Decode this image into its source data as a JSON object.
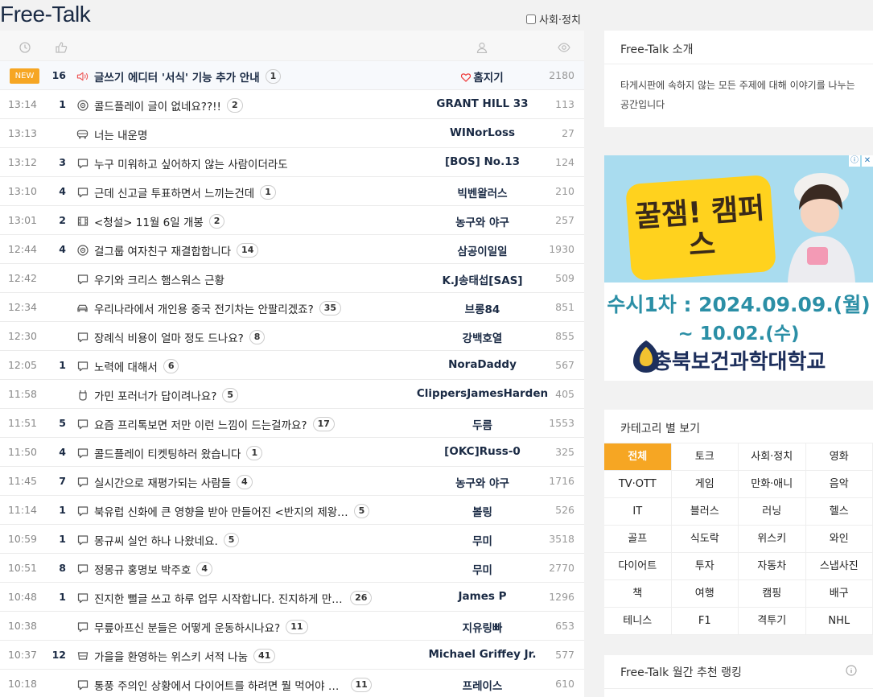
{
  "header": {
    "title": "Free-Talk",
    "filter_label": "사회·정치"
  },
  "board": {
    "new_label": "NEW",
    "rows": [
      {
        "time": "",
        "is_notice": true,
        "rec": "16",
        "icon": "speaker-icon",
        "title": "글쓰기 에디터 '서식' 기능 추가 안내",
        "comments": "1",
        "author": "홈지기",
        "views": "2180"
      },
      {
        "time": "13:14",
        "rec": "1",
        "icon": "target-icon",
        "title": "콜드플레이 글이 없네요??!!",
        "comments": "2",
        "author": "GRANT HILL 33",
        "views": "113"
      },
      {
        "time": "13:13",
        "rec": "",
        "icon": "bus-icon",
        "title": "너는 내운명",
        "comments": "",
        "author": "WINorLoss",
        "views": "27"
      },
      {
        "time": "13:12",
        "rec": "3",
        "icon": "chat-icon",
        "title": "누구 미워하고 싶어하지 않는 사람이더라도",
        "comments": "",
        "author": "[BOS] No.13",
        "views": "124"
      },
      {
        "time": "13:10",
        "rec": "4",
        "icon": "chat-icon",
        "title": "근데 신고글 투표하면서 느끼는건데",
        "comments": "1",
        "author": "빅벤왈러스",
        "views": "210"
      },
      {
        "time": "13:01",
        "rec": "2",
        "icon": "film-icon",
        "title": "<청설> 11월 6일 개봉",
        "comments": "2",
        "author": "농구와 야구",
        "views": "257"
      },
      {
        "time": "12:44",
        "rec": "4",
        "icon": "target-icon",
        "title": "걸그룹 여자친구 재결합합니다",
        "comments": "14",
        "author": "삼공이일일",
        "views": "1930"
      },
      {
        "time": "12:42",
        "rec": "",
        "icon": "chat-icon",
        "title": "우기와 크리스 햄스워스 근황",
        "comments": "",
        "author": "K.J송태섭[SAS]",
        "views": "509"
      },
      {
        "time": "12:34",
        "rec": "",
        "icon": "car-icon",
        "title": "우리나라에서 개인용 중국 전기차는 안팔리겠죠?",
        "comments": "35",
        "author": "브롱84",
        "views": "851"
      },
      {
        "time": "12:30",
        "rec": "",
        "icon": "chat-icon",
        "title": "장례식 비용이 얼마 정도 드나요?",
        "comments": "8",
        "author": "강백호열",
        "views": "855"
      },
      {
        "time": "12:05",
        "rec": "1",
        "icon": "chat-icon",
        "title": "노력에 대해서",
        "comments": "6",
        "author": "NoraDaddy",
        "views": "567"
      },
      {
        "time": "11:58",
        "rec": "",
        "icon": "shoe-icon",
        "title": "가민 포러너가 답이려나요?",
        "comments": "5",
        "author": "ClippersJamesHarden",
        "views": "405"
      },
      {
        "time": "11:51",
        "rec": "5",
        "icon": "chat-icon",
        "title": "요즘 프리톡보면 저만 이런 느낌이 드는걸까요?",
        "comments": "17",
        "author": "두름",
        "views": "1553"
      },
      {
        "time": "11:50",
        "rec": "4",
        "icon": "chat-icon",
        "title": "콜드플레이 티켓팅하러 왔습니다",
        "comments": "1",
        "author": "[OKC]Russ-0",
        "views": "325"
      },
      {
        "time": "11:45",
        "rec": "7",
        "icon": "chat-icon",
        "title": "실시간으로 재평가되는 사람들",
        "comments": "4",
        "author": "농구와 야구",
        "views": "1716"
      },
      {
        "time": "11:14",
        "rec": "1",
        "icon": "chat-icon",
        "title": "북유럽 신화에 큰 영향을 받아 만들어진 <반지의 제왕…",
        "comments": "5",
        "author": "볼링",
        "views": "526"
      },
      {
        "time": "10:59",
        "rec": "1",
        "icon": "chat-icon",
        "title": "몽규씨 실언 하나 나왔네요.",
        "comments": "5",
        "author": "무미",
        "views": "3518"
      },
      {
        "time": "10:51",
        "rec": "8",
        "icon": "chat-icon",
        "title": "정몽규 홍명보 박주호",
        "comments": "4",
        "author": "무미",
        "views": "2770"
      },
      {
        "time": "10:48",
        "rec": "1",
        "icon": "chat-icon",
        "title": "진지한 뻘글 쓰고 하루 업무 시작합니다. 진지하게 만나…",
        "comments": "26",
        "author": "James P",
        "views": "1296"
      },
      {
        "time": "10:38",
        "rec": "",
        "icon": "chat-icon",
        "title": "무릎아프신 분들은 어떻게 운동하시나요?",
        "comments": "11",
        "author": "지유링빠",
        "views": "653"
      },
      {
        "time": "10:37",
        "rec": "12",
        "icon": "glass-icon",
        "title": "가을을 환영하는 위스키 서적 나눔",
        "comments": "41",
        "author": "Michael Griffey Jr.",
        "views": "577"
      },
      {
        "time": "10:18",
        "rec": "",
        "icon": "chat-icon",
        "title": "통풍 주의인 상황에서 다이어트를 하려면 뭘 먹어야 하나…",
        "comments": "11",
        "author": "프레이스",
        "views": "610"
      }
    ]
  },
  "sidebar": {
    "intro_title": "Free-Talk 소개",
    "intro_text": "타게시판에 속하지 않는 모든 주제에 대해 이야기를 나누는 공간입니다",
    "ad": {
      "line1": "수시1차 : 2024.09.09.(월)",
      "line2": "~ 10.02.(수)",
      "school": "충북보건과학대학교",
      "yellow_text": "꿀잼! 캠퍼스"
    },
    "category_title": "카테고리 별 보기",
    "categories": [
      "전체",
      "토크",
      "사회·정치",
      "영화",
      "TV·OTT",
      "게임",
      "만화·애니",
      "음악",
      "IT",
      "블러스",
      "러닝",
      "헬스",
      "골프",
      "식도락",
      "위스키",
      "와인",
      "다이어트",
      "투자",
      "자동차",
      "스냅사진",
      "책",
      "여행",
      "캠핑",
      "배구",
      "테니스",
      "F1",
      "격투기",
      "NHL"
    ],
    "active_category": "전체",
    "ranking_title": "Free-Talk 월간 추천 랭킹"
  },
  "colors": {
    "accent": "#f6a623",
    "navy": "#1a2a44",
    "heart": "#e33"
  }
}
